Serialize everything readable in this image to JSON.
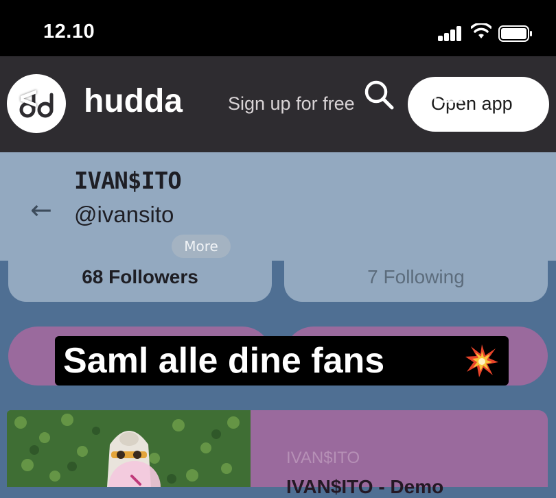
{
  "status_bar": {
    "time": "12.10",
    "icons": [
      "signal-icon",
      "wifi-icon",
      "battery-icon"
    ]
  },
  "header": {
    "back_glyph": "<",
    "brand": "hudda",
    "signup_link": "Sign up for free",
    "open_app_label": "Open app",
    "kebab_glyph": "⋮",
    "icons": [
      "search-icon",
      "camera-icon",
      "more-vertical-icon"
    ]
  },
  "profile": {
    "display_name": "IVAN$ITO",
    "back_arrow": "←",
    "handle": "@ivansito",
    "more_label": "More"
  },
  "stats": {
    "followers": "68 Followers",
    "following": "7 Following"
  },
  "caption": {
    "text": "Saml alle dine fans",
    "emoji_icon": "collision-burst-icon"
  },
  "content_card": {
    "artist": "IVAN$ITO",
    "title": "IVAN$ITO - Demo"
  },
  "colors": {
    "header_bg": "#2e2c30",
    "profile_bg": "#93a9c0",
    "page_bg": "#4f6f93",
    "accent_purple": "#9a6a9d"
  }
}
